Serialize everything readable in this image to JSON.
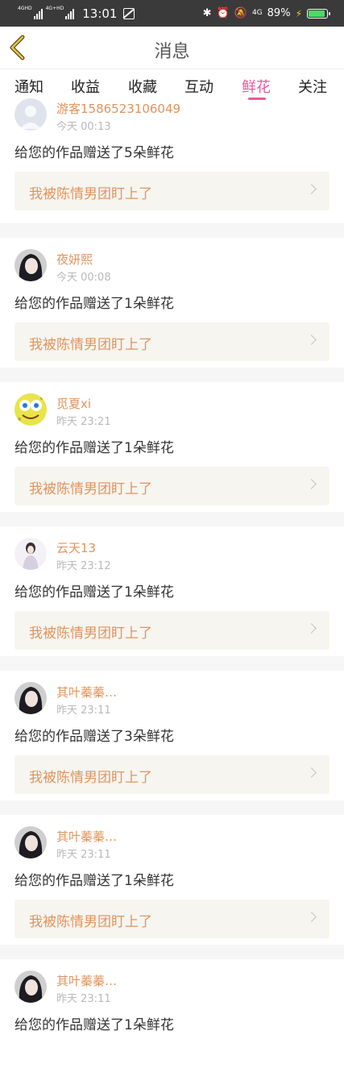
{
  "status_bar": {
    "sim1_label": "4GHD",
    "sim2_label": "4G+HD",
    "time": "13:01",
    "network_label": "4G",
    "battery_percent_text": "89%",
    "battery_level": 0.89
  },
  "header": {
    "title": "消息"
  },
  "tabs": [
    {
      "label": "通知"
    },
    {
      "label": "收益"
    },
    {
      "label": "收藏"
    },
    {
      "label": "互动"
    },
    {
      "label": "鲜花",
      "active": true
    },
    {
      "label": "关注"
    }
  ],
  "messages": [
    {
      "user": "游客1586523106049",
      "time": "今天 00:13",
      "text": "给您的作品赠送了5朵鲜花",
      "work": "我被陈情男团盯上了",
      "avatar": "default-avatar"
    },
    {
      "user": "夜妍熙",
      "time": "今天 00:08",
      "text": "给您的作品赠送了1朵鲜花",
      "work": "我被陈情男团盯上了",
      "avatar": "dark-portrait"
    },
    {
      "user": "觅夏xi",
      "time": "昨天 23:21",
      "text": "给您的作品赠送了1朵鲜花",
      "work": "我被陈情男团盯上了",
      "avatar": "cartoon-sponge"
    },
    {
      "user": "云天13",
      "time": "昨天 23:12",
      "text": "给您的作品赠送了1朵鲜花",
      "work": "我被陈情男团盯上了",
      "avatar": "light-portrait"
    },
    {
      "user": "其叶蓁蓁…",
      "time": "昨天 23:11",
      "text": "给您的作品赠送了3朵鲜花",
      "work": "我被陈情男团盯上了",
      "avatar": "dark-portrait"
    },
    {
      "user": "其叶蓁蓁…",
      "time": "昨天 23:11",
      "text": "给您的作品赠送了1朵鲜花",
      "work": "我被陈情男团盯上了",
      "avatar": "dark-portrait"
    },
    {
      "user": "其叶蓁蓁…",
      "time": "昨天 23:11",
      "text": "给您的作品赠送了1朵鲜花",
      "work": "",
      "avatar": "dark-portrait"
    }
  ],
  "colors": {
    "accent": "#e75a9b",
    "username": "#e0945e",
    "work_bg": "#f6f5ef"
  }
}
